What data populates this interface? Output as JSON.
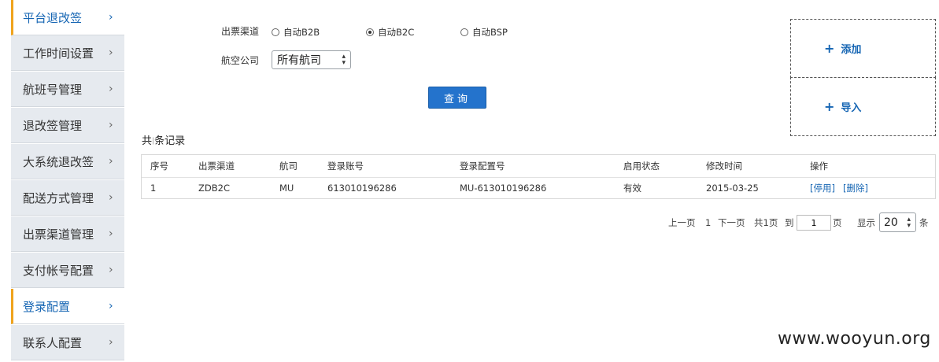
{
  "sidebar": {
    "items": [
      {
        "label": "平台退改签",
        "active": true
      },
      {
        "label": "工作时间设置",
        "active": false
      },
      {
        "label": "航班号管理",
        "active": false
      },
      {
        "label": "退改签管理",
        "active": false
      },
      {
        "label": "大系统退改签",
        "active": false
      },
      {
        "label": "配送方式管理",
        "active": false
      },
      {
        "label": "出票渠道管理",
        "active": false
      },
      {
        "label": "支付帐号配置",
        "active": false
      },
      {
        "label": "登录配置",
        "active": true
      },
      {
        "label": "联系人配置",
        "active": false
      }
    ],
    "chevron": "›"
  },
  "form": {
    "channel_label": "出票渠道",
    "channel_options": [
      {
        "label": "自动B2B",
        "checked": false
      },
      {
        "label": "自动B2C",
        "checked": true
      },
      {
        "label": "自动BSP",
        "checked": false
      }
    ],
    "airline_label": "航空公司",
    "airline_value": "所有航司",
    "query_button": "查询"
  },
  "actions": {
    "add_label": "添加",
    "import_label": "导入",
    "plus_icon": "+"
  },
  "records": {
    "prefix": "共",
    "separator": "|",
    "suffix": "条记录"
  },
  "table": {
    "headers": [
      "序号",
      "出票渠道",
      "航司",
      "登录账号",
      "登录配置号",
      "启用状态",
      "修改时间",
      "操作"
    ],
    "rows": [
      {
        "index": "1",
        "channel": "ZDB2C",
        "airline": "MU",
        "account": "613010196286",
        "config_no": "MU-613010196286",
        "status": "有效",
        "modified": "2015-03-25",
        "action_disable": "[停用]",
        "action_delete": "[删除]"
      }
    ]
  },
  "pagination": {
    "prev": "上一页",
    "current": "1",
    "next": "下一页",
    "total": "共1页",
    "goto_prefix": "到",
    "goto_value": "1",
    "goto_suffix": "页",
    "show_prefix": "显示",
    "page_size": "20",
    "show_suffix": "条"
  },
  "watermark": "www.wooyun.org",
  "colors": {
    "accent": "#2473cc",
    "link": "#1565b3",
    "active_bar": "#f0a31c",
    "sidebar_bg": "#e6eaef"
  }
}
